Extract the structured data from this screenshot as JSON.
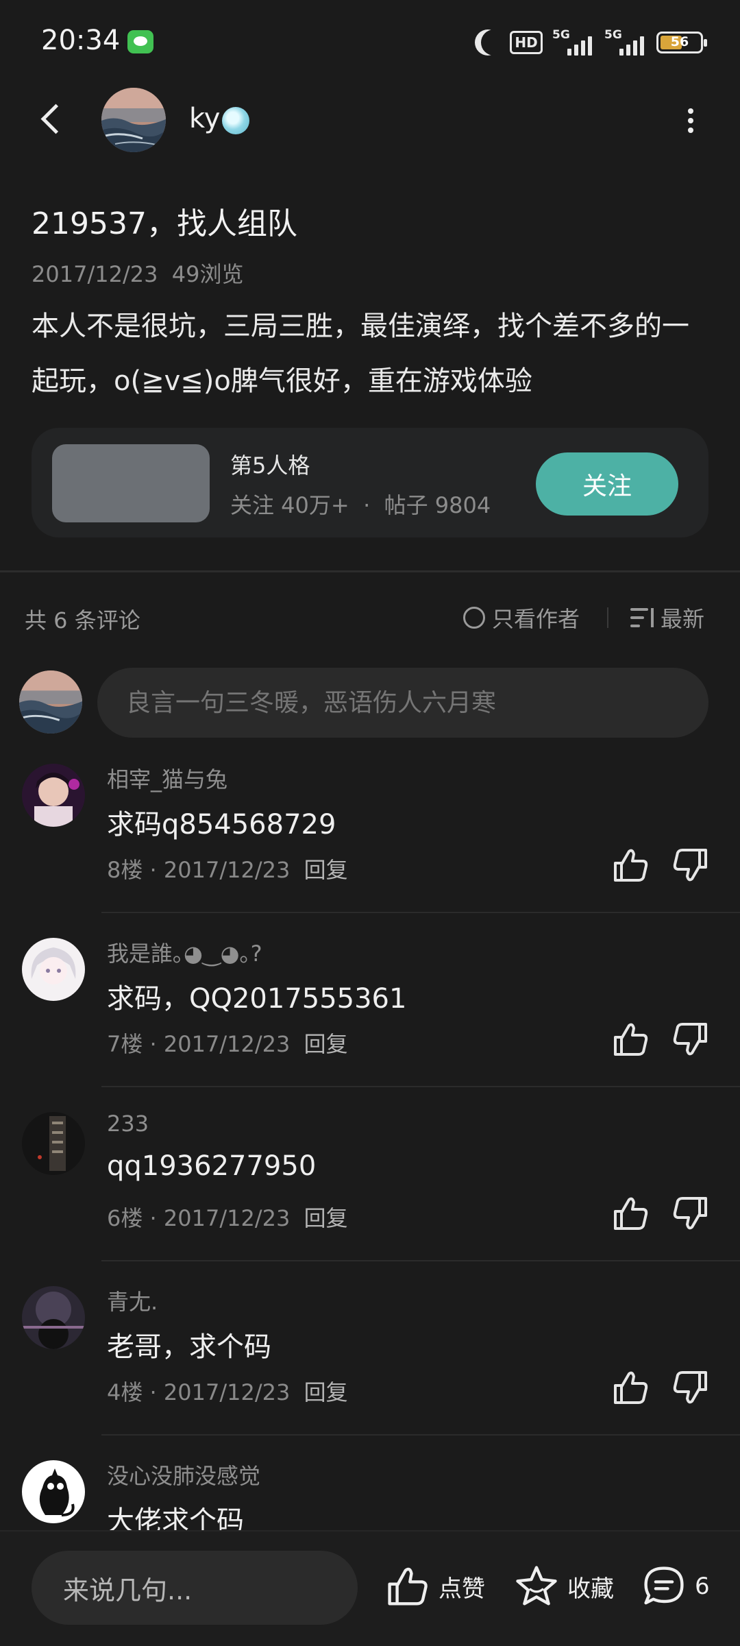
{
  "status_bar": {
    "time": "20:34",
    "hd_label": "HD",
    "network_1": "5G",
    "network_2": "5G",
    "battery": "56"
  },
  "nav": {
    "author_name": "ky"
  },
  "post": {
    "title": "219537，找人组队",
    "date": "2017/12/23",
    "views": "49浏览",
    "body": "本人不是很坑，三局三胜，最佳演绎，找个差不多的一起玩，o(≧v≦)o脾气很好，重在游戏体验"
  },
  "game_card": {
    "name": "第5人格",
    "followers": "关注 40万+",
    "dot": "·",
    "posts": "帖子 9804",
    "follow_label": "关注"
  },
  "comments_header": {
    "count": "共 6 条评论",
    "only_author": "只看作者",
    "sort": "最新"
  },
  "comment_input": {
    "placeholder": "良言一句三冬暖，恶语伤人六月寒"
  },
  "comments": [
    {
      "user": "相宰_猫与兔",
      "text": "求码q854568729",
      "floor": "8楼",
      "date": "2017/12/23",
      "reply": "回复"
    },
    {
      "user": "我是誰｡◕‿◕｡?",
      "text": "求码，QQ2017555361",
      "floor": "7楼",
      "date": "2017/12/23",
      "reply": "回复"
    },
    {
      "user": "233",
      "text": "qq1936277950",
      "floor": "6楼",
      "date": "2017/12/23",
      "reply": "回复"
    },
    {
      "user": "青尢.",
      "text": "老哥，求个码",
      "floor": "4楼",
      "date": "2017/12/23",
      "reply": "回复"
    },
    {
      "user": "没心没肺没感觉",
      "text": "大佬求个码",
      "floor": "",
      "date": "",
      "reply": ""
    }
  ],
  "bottom_bar": {
    "input_placeholder": "来说几句...",
    "like_label": "点赞",
    "favorite_label": "收藏",
    "comment_count": "6"
  },
  "colors": {
    "background": "#1b1b1b",
    "accent": "#4db1a5",
    "secondary_text": "#8c8c8c"
  }
}
